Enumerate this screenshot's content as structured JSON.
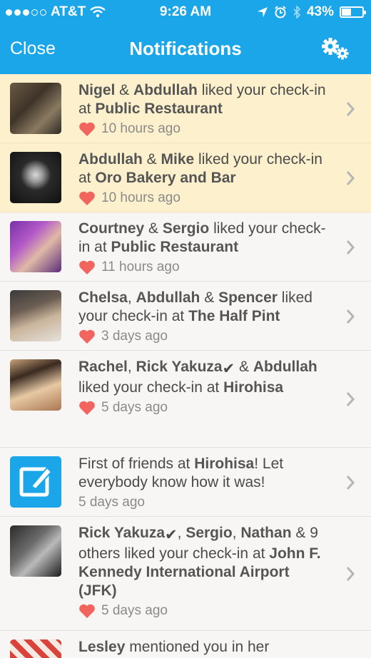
{
  "status": {
    "carrier": "AT&T",
    "time": "9:26 AM",
    "battery": "43%",
    "battery_level": 0.43
  },
  "nav": {
    "close_label": "Close",
    "title": "Notifications",
    "settings_icon": "gear-icon"
  },
  "colors": {
    "brand": "#1aa6e8",
    "unread": "#fcf0cd",
    "heart": "#f2655e"
  },
  "notifications": [
    {
      "parts": [
        [
          "b",
          "Nigel"
        ],
        [
          "t",
          " & "
        ],
        [
          "b",
          "Abdullah"
        ],
        [
          "t",
          " liked your check-in at "
        ],
        [
          "b",
          "Public Restaurant"
        ]
      ],
      "time": "10 hours ago",
      "heart": true,
      "unread": true
    },
    {
      "parts": [
        [
          "b",
          "Abdullah"
        ],
        [
          "t",
          " & "
        ],
        [
          "b",
          "Mike"
        ],
        [
          "t",
          " liked your check-in at "
        ],
        [
          "b",
          "Oro Bakery and Bar"
        ]
      ],
      "time": "10 hours ago",
      "heart": true,
      "unread": true
    },
    {
      "parts": [
        [
          "b",
          "Courtney"
        ],
        [
          "t",
          " & "
        ],
        [
          "b",
          "Sergio"
        ],
        [
          "t",
          " liked your check-in at "
        ],
        [
          "b",
          "Public Restaurant"
        ]
      ],
      "time": "11 hours ago",
      "heart": true,
      "unread": false
    },
    {
      "parts": [
        [
          "b",
          "Chelsa"
        ],
        [
          "t",
          ", "
        ],
        [
          "b",
          "Abdullah"
        ],
        [
          "t",
          " & "
        ],
        [
          "b",
          "Spencer"
        ],
        [
          "t",
          " liked your check-in at "
        ],
        [
          "b",
          "The Half Pint"
        ]
      ],
      "time": "3 days ago",
      "heart": true,
      "unread": false
    },
    {
      "parts": [
        [
          "b",
          "Rachel"
        ],
        [
          "t",
          ", "
        ],
        [
          "b",
          "Rick Yakuza"
        ],
        [
          "c",
          "✔"
        ],
        [
          "t",
          " & "
        ],
        [
          "b",
          "Abdullah"
        ],
        [
          "t",
          " liked your check-in at "
        ],
        [
          "b",
          "Hirohisa"
        ]
      ],
      "time": "5 days ago",
      "heart": true,
      "unread": false
    },
    {
      "parts": [
        [
          "t",
          "First of friends at "
        ],
        [
          "b",
          "Hirohisa"
        ],
        [
          "t",
          "! Let everybody know how it was!"
        ]
      ],
      "time": "5 days ago",
      "heart": false,
      "unread": false
    },
    {
      "parts": [
        [
          "b",
          "Rick Yakuza"
        ],
        [
          "c",
          "✔"
        ],
        [
          "t",
          ", "
        ],
        [
          "b",
          "Sergio"
        ],
        [
          "t",
          ", "
        ],
        [
          "b",
          "Nathan"
        ],
        [
          "t",
          " & 9 others liked your check-in at "
        ],
        [
          "b",
          "John F. Kennedy International Airport (JFK)"
        ]
      ],
      "time": "5 days ago",
      "heart": true,
      "unread": false
    },
    {
      "parts": [
        [
          "b",
          "Lesley"
        ],
        [
          "t",
          " mentioned you in her"
        ]
      ],
      "time": "",
      "heart": false,
      "unread": false
    }
  ]
}
